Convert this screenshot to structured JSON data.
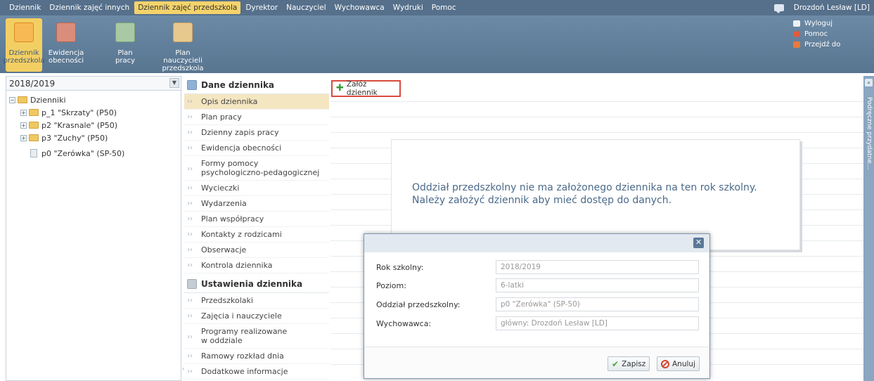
{
  "topmenu": {
    "items": [
      "Dziennik",
      "Dziennik zajęć innych",
      "Dziennik zajęć przedszkola",
      "Dyrektor",
      "Nauczyciel",
      "Wychowawca",
      "Wydruki",
      "Pomoc"
    ],
    "active_index": 2,
    "user": "Drozdoń Lesław [LD]"
  },
  "ribbon": {
    "buttons": [
      {
        "label": "Dziennik przedszkola",
        "icon": "children-icon"
      },
      {
        "label": "Ewidencja obecności",
        "icon": "attendance-icon"
      },
      {
        "label": "Plan pracy",
        "icon": "plan-icon"
      },
      {
        "label": "Plan nauczycieli przedszkola",
        "icon": "teachers-plan-icon"
      }
    ],
    "links": [
      "Wyloguj",
      "Pomoc",
      "Przejdź do"
    ]
  },
  "left": {
    "year": "2018/2019",
    "root": "Dzienniki",
    "groups": [
      "p_1 \"Skrzaty\" (P50)",
      "p2 \"Krasnale\" (P50)",
      "p3 \"Zuchy\" (P50)"
    ],
    "selected": "p0 \"Zerówka\" (SP-50)"
  },
  "nav": {
    "section1": "Dane dziennika",
    "items1": [
      "Opis dziennika",
      "Plan pracy",
      "Dzienny zapis pracy",
      "Ewidencja obecności",
      "Formy pomocy psychologiczno-pedagogicznej",
      "Wycieczki",
      "Wydarzenia",
      "Plan współpracy",
      "Kontakty z rodzicami",
      "Obserwacje",
      "Kontrola dziennika"
    ],
    "section2": "Ustawienia dziennika",
    "items2": [
      "Przedszkolaki",
      "Zajęcia i nauczyciele",
      "Programy realizowane w oddziale",
      "Ramowy rozkład dnia",
      "Dodatkowe informacje"
    ]
  },
  "main": {
    "create_button": "Załóż dziennik",
    "notice_line1": "Oddział przedszkolny nie ma założonego dziennika na ten rok szkolny.",
    "notice_line2": "Należy założyć dziennik aby mieć dostęp do danych."
  },
  "side_panel": {
    "label": "Podręczne przydatne..."
  },
  "dialog": {
    "rows": [
      {
        "label": "Rok szkolny:",
        "value": "2018/2019"
      },
      {
        "label": "Poziom:",
        "value": "6-latki"
      },
      {
        "label": "Oddział przedszkolny:",
        "value": "p0 \"Zerówka\" (SP-50)"
      },
      {
        "label": "Wychowawca:",
        "value": "główny: Drozdoń Lesław [LD]"
      }
    ],
    "save": "Zapisz",
    "cancel": "Anuluj"
  }
}
